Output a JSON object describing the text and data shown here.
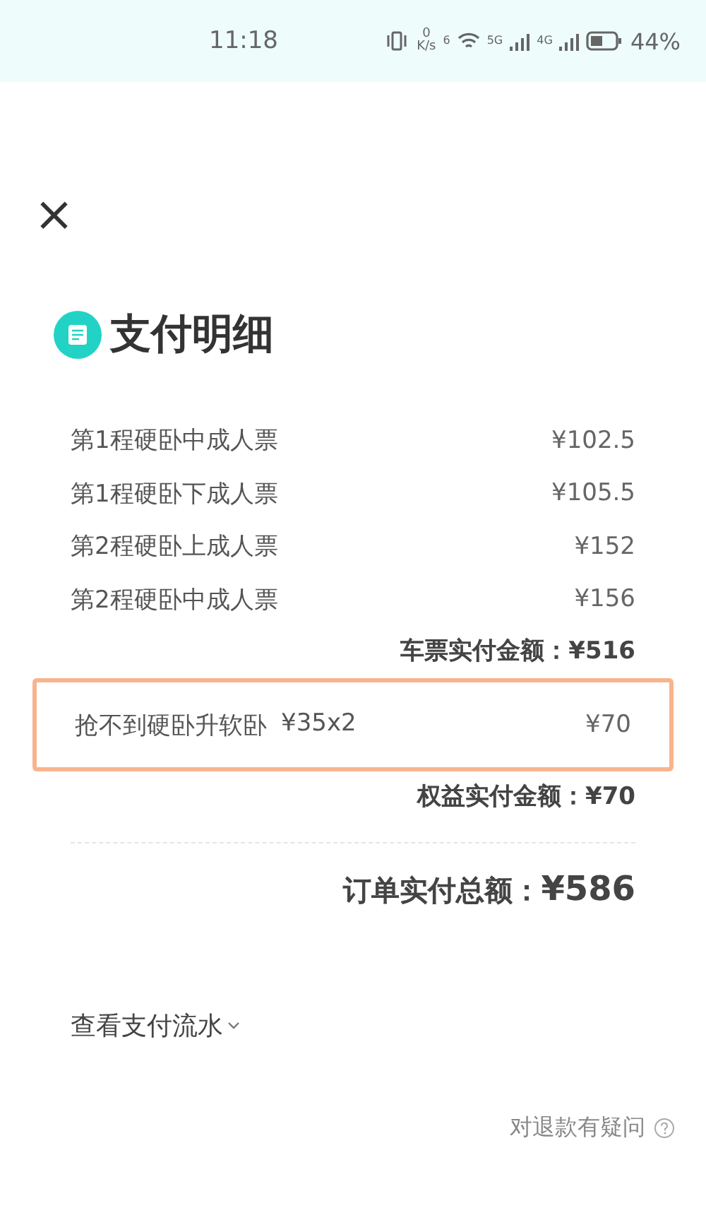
{
  "status_bar": {
    "time": "11:18",
    "speed_value": "0",
    "speed_unit": "K/s",
    "wifi_label": "6",
    "sim1_label": "5G",
    "sim2_label": "4G",
    "battery": "44%"
  },
  "close_button": {
    "label": "×"
  },
  "title": "支付明细",
  "tickets": [
    {
      "label": "第1程硬卧中成人票",
      "amount": "¥102.5"
    },
    {
      "label": "第1程硬卧下成人票",
      "amount": "¥105.5"
    },
    {
      "label": "第2程硬卧上成人票",
      "amount": "¥152"
    },
    {
      "label": "第2程硬卧中成人票",
      "amount": "¥156"
    }
  ],
  "ticket_total": "车票实付金额：¥516",
  "benefits": [
    {
      "label": "抢不到硬卧升软卧",
      "unit": "¥35x2",
      "amount": "¥70",
      "highlighted": true
    }
  ],
  "benefit_total": "权益实付金额：¥70",
  "order_total": {
    "label": "订单实付总额：",
    "amount": "¥586"
  },
  "payment_flow_link": "查看支付流水",
  "refund_help_link": "对退款有疑问"
}
